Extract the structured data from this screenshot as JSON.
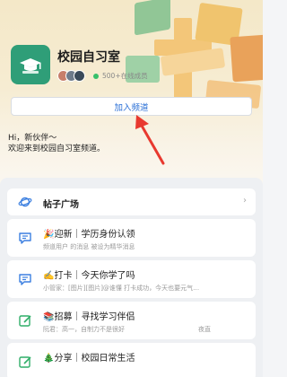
{
  "channel": {
    "name": "校园自习室",
    "members": "500+在线成员",
    "join_label": "加入频道",
    "welcome_line1": "Hi，新伙伴～",
    "welcome_line2": "欢迎来到校园自习室频道。"
  },
  "section": {
    "title": "帖子广场"
  },
  "posts": [
    {
      "emoji": "🎉",
      "title": "迎新｜学历身份认领",
      "sub": "频道用户 的消息 被设为精华消息",
      "right": ""
    },
    {
      "emoji": "✍️",
      "title": "打卡｜今天你学了吗",
      "sub": "小管家：[图片][图片]@谁懂 打卡成功，今天也要元气…",
      "right": ""
    },
    {
      "emoji": "📚",
      "title": "招募｜寻找学习伴侣",
      "sub": "阮君：高一，自制力不是很好",
      "right": "夜直"
    },
    {
      "emoji": "🎄",
      "title": "分享｜校园日常生活",
      "sub": "",
      "right": ""
    }
  ],
  "colors": {
    "accent": "#2a6fd6",
    "icon_bg": "#2f9e78",
    "arrow": "#e8392f"
  },
  "icons": {
    "channel": "graduation-cap-icon",
    "section": "planet-icon",
    "post": "chat-bubble-icon",
    "edit": "edit-square-icon"
  }
}
